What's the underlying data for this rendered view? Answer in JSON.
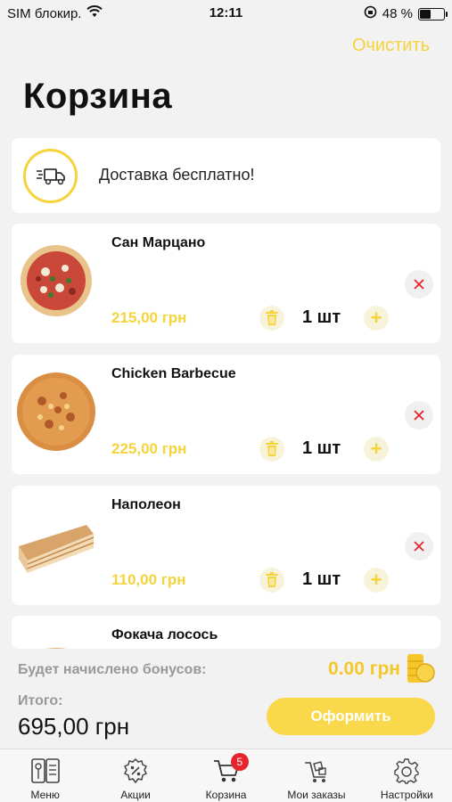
{
  "status_bar": {
    "carrier": "SIM блокир.",
    "time": "12:11",
    "battery": "48 %",
    "battery_level": 0.48
  },
  "header": {
    "clear_label": "Очистить",
    "title": "Корзина"
  },
  "delivery": {
    "text": "Доставка бесплатно!",
    "icon": "truck-icon"
  },
  "items": [
    {
      "name": "Сан Марцано",
      "price": "215,00 грн",
      "quantity": "1 шт",
      "image": "pizza-image"
    },
    {
      "name": "Chicken Barbecue",
      "price": "225,00 грн",
      "quantity": "1 шт",
      "image": "pizza-image"
    },
    {
      "name": "Наполеон",
      "price": "110,00 грн",
      "quantity": "1 шт",
      "image": "cake-image"
    },
    {
      "name": "Фокача лосось",
      "price": "",
      "quantity": "",
      "image": "focaccia-image"
    }
  ],
  "summary": {
    "bonus_label": "Будет начислено бонусов:",
    "bonus_value": "0.00 грн",
    "total_label": "Итого:",
    "total_value": "695,00 грн",
    "checkout_label": "Оформить"
  },
  "tabs": [
    {
      "label": "Меню",
      "icon": "menu-book-icon"
    },
    {
      "label": "Акции",
      "icon": "discount-icon"
    },
    {
      "label": "Корзина",
      "icon": "cart-icon",
      "badge": "5"
    },
    {
      "label": "Мои заказы",
      "icon": "orders-cart-icon"
    },
    {
      "label": "Настройки",
      "icon": "gear-icon"
    }
  ],
  "colors": {
    "accent": "#f5d33a",
    "badge": "#e5242b",
    "remove": "#e5242b"
  }
}
